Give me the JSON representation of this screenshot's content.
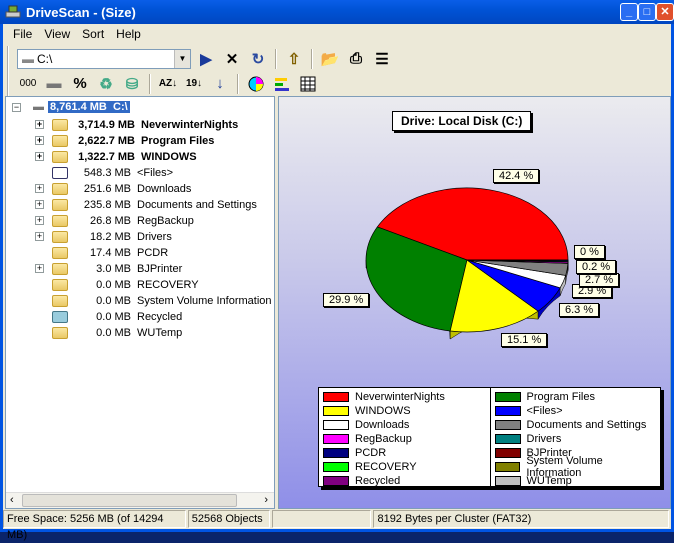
{
  "window": {
    "title": "DriveScan - (Size)"
  },
  "menu": [
    "File",
    "View",
    "Sort",
    "Help"
  ],
  "toolbar": {
    "path": "C:\\",
    "digits_label": "000",
    "percent_label": "%"
  },
  "tree": {
    "root": {
      "size": "8,761.4 MB",
      "name": "C:\\"
    },
    "items": [
      {
        "size": "3,714.9 MB",
        "name": "NeverwinterNights",
        "bold": true,
        "expandable": true,
        "icon": "folder"
      },
      {
        "size": "2,622.7 MB",
        "name": "Program Files",
        "bold": true,
        "expandable": true,
        "icon": "folder"
      },
      {
        "size": "1,322.7 MB",
        "name": "WINDOWS",
        "bold": true,
        "expandable": true,
        "icon": "folder"
      },
      {
        "size": "548.3 MB",
        "name": "<Files>",
        "bold": false,
        "expandable": false,
        "icon": "files"
      },
      {
        "size": "251.6 MB",
        "name": "Downloads",
        "bold": false,
        "expandable": true,
        "icon": "folder"
      },
      {
        "size": "235.8 MB",
        "name": "Documents and Settings",
        "bold": false,
        "expandable": true,
        "icon": "folder"
      },
      {
        "size": "26.8 MB",
        "name": "RegBackup",
        "bold": false,
        "expandable": true,
        "icon": "folder"
      },
      {
        "size": "18.2 MB",
        "name": "Drivers",
        "bold": false,
        "expandable": true,
        "icon": "folder"
      },
      {
        "size": "17.4 MB",
        "name": "PCDR",
        "bold": false,
        "expandable": false,
        "icon": "folder"
      },
      {
        "size": "3.0 MB",
        "name": "BJPrinter",
        "bold": false,
        "expandable": true,
        "icon": "folder"
      },
      {
        "size": "0.0 MB",
        "name": "RECOVERY",
        "bold": false,
        "expandable": false,
        "icon": "folder"
      },
      {
        "size": "0.0 MB",
        "name": "System Volume Information",
        "bold": false,
        "expandable": false,
        "icon": "folder"
      },
      {
        "size": "0.0 MB",
        "name": "Recycled",
        "bold": false,
        "expandable": false,
        "icon": "recycle-bin"
      },
      {
        "size": "0.0 MB",
        "name": "WUTemp",
        "bold": false,
        "expandable": false,
        "icon": "folder"
      }
    ]
  },
  "chart_data": {
    "type": "pie",
    "title": "Drive: Local Disk (C:)",
    "slices": [
      {
        "name": "NeverwinterNights",
        "value": 3714.9,
        "color": "#ff0000",
        "label": "42.4 %"
      },
      {
        "name": "Program Files",
        "value": 2622.7,
        "color": "#008000",
        "label": "29.9 %"
      },
      {
        "name": "WINDOWS",
        "value": 1322.7,
        "color": "#ffff00",
        "label": "15.1 %"
      },
      {
        "name": "<Files>",
        "value": 548.3,
        "color": "#0000ff",
        "label": "6.3 %"
      },
      {
        "name": "Downloads",
        "value": 251.6,
        "color": "#ffffff",
        "label": "2.9 %"
      },
      {
        "name": "Documents and Settings",
        "value": 235.8,
        "color": "#808080",
        "label": "2.7 %"
      },
      {
        "name": "RegBackup",
        "value": 26.8,
        "color": "#ff00ff",
        "label": "0.2 %"
      },
      {
        "name": "Drivers",
        "value": 18.2,
        "color": "#008080",
        "label": ""
      },
      {
        "name": "PCDR",
        "value": 17.4,
        "color": "#000080",
        "label": ""
      },
      {
        "name": "BJPrinter",
        "value": 3.0,
        "color": "#800000",
        "label": "0 %"
      },
      {
        "name": "RECOVERY",
        "value": 0,
        "color": "#00ff00",
        "label": ""
      },
      {
        "name": "System Volume Information",
        "value": 0,
        "color": "#808000",
        "label": ""
      },
      {
        "name": "Recycled",
        "value": 0,
        "color": "#800080",
        "label": ""
      },
      {
        "name": "WUTemp",
        "value": 0,
        "color": "#c0c0c0",
        "label": ""
      }
    ],
    "legend_placement": "bottom"
  },
  "status": {
    "free": "Free Space: 5256 MB (of 14294 MB)",
    "objects": "52568 Objects",
    "cluster": "8192 Bytes per Cluster (FAT32)"
  }
}
